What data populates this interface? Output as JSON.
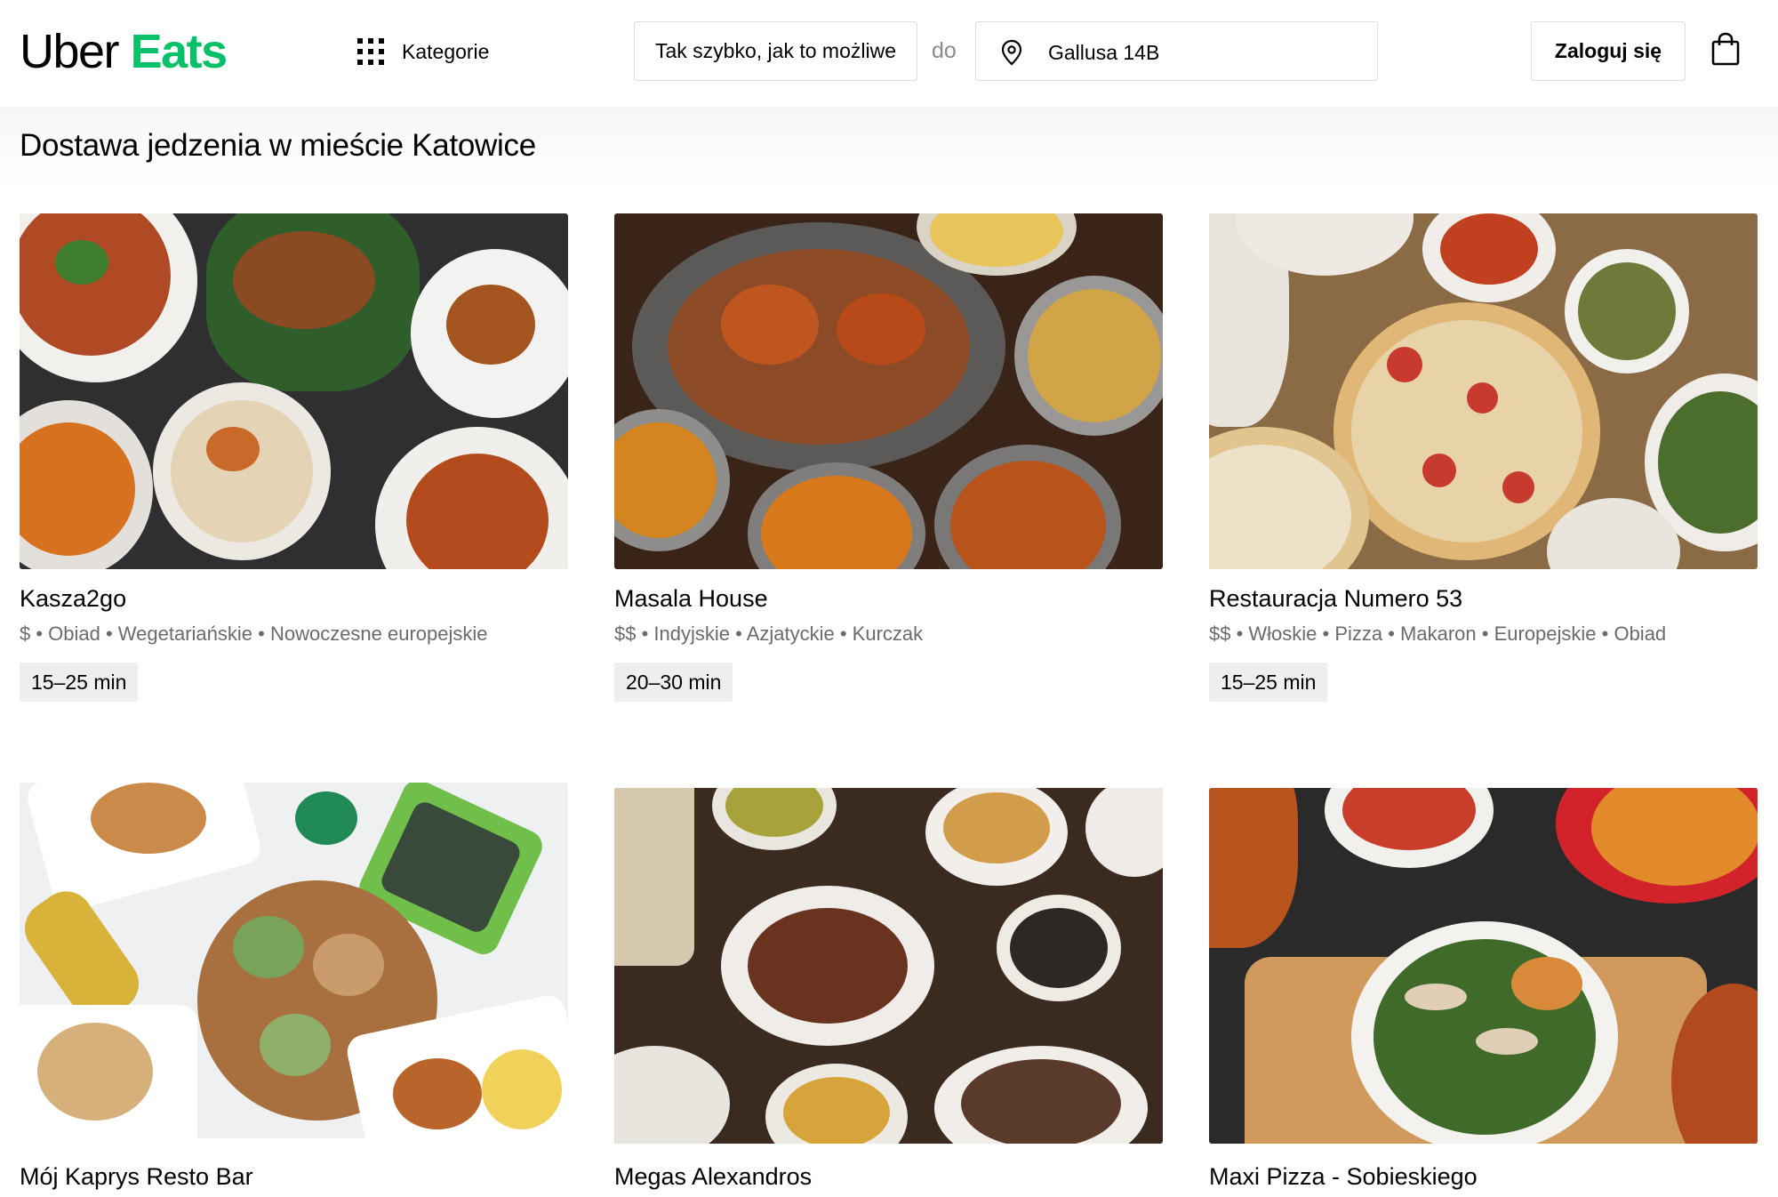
{
  "header": {
    "logo_primary": "Uber",
    "logo_secondary": "Eats",
    "categories_label": "Kategorie",
    "delivery_time": "Tak szybko, jak to możliwe",
    "to_label": "do",
    "address": "Gallusa 14B",
    "login_label": "Zaloguj się"
  },
  "page_title": "Dostawa jedzenia w mieście Katowice",
  "restaurants": [
    {
      "name": "Kasza2go",
      "meta": "$ • Obiad • Wegetariańskie • Nowoczesne europejskie",
      "eta": "15–25 min"
    },
    {
      "name": "Masala House",
      "meta": "$$ • Indyjskie • Azjatyckie • Kurczak",
      "eta": "20–30 min"
    },
    {
      "name": "Restauracja Numero 53",
      "meta": "$$ • Włoskie • Pizza • Makaron • Europejskie • Obiad",
      "eta": "15–25 min"
    },
    {
      "name": "Mój Kaprys Resto Bar"
    },
    {
      "name": "Megas Alexandros"
    },
    {
      "name": "Maxi Pizza - Sobieskiego"
    }
  ],
  "colors": {
    "brand_green": "#06c167",
    "text": "#000000",
    "muted": "#6b6b6b",
    "badge_bg": "#eeeeee"
  },
  "icons": [
    "grid-icon",
    "location-pin-icon",
    "shopping-bag-icon"
  ]
}
